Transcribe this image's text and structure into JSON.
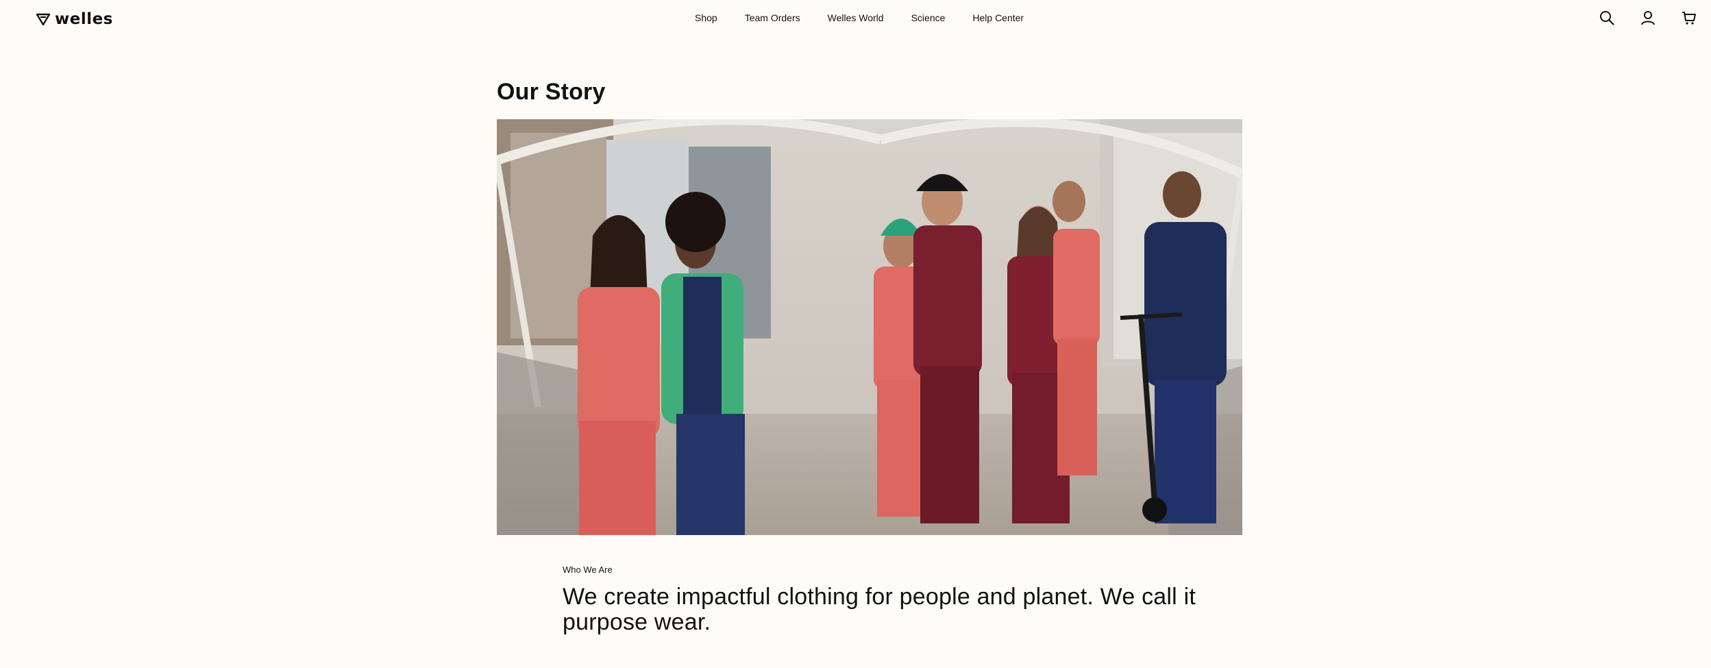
{
  "header": {
    "logo_text": "welles",
    "logo_icon": "heart-shield-icon",
    "nav": [
      {
        "label": "Shop"
      },
      {
        "label": "Team Orders"
      },
      {
        "label": "Welles World"
      },
      {
        "label": "Science"
      },
      {
        "label": "Help Center"
      }
    ],
    "icons": [
      "search-icon",
      "account-icon",
      "cart-icon"
    ]
  },
  "main": {
    "title": "Our Story",
    "section_eyebrow": "Who We Are",
    "headline": "We create impactful clothing for people and planet. We call it purpose wear."
  },
  "colors": {
    "background": "#fffcf7",
    "text": "#111111",
    "scrub_coral": "#e06a64",
    "scrub_burgundy": "#7a1f2e",
    "scrub_navy": "#1f2d5a",
    "scrub_green": "#3fae7a"
  }
}
